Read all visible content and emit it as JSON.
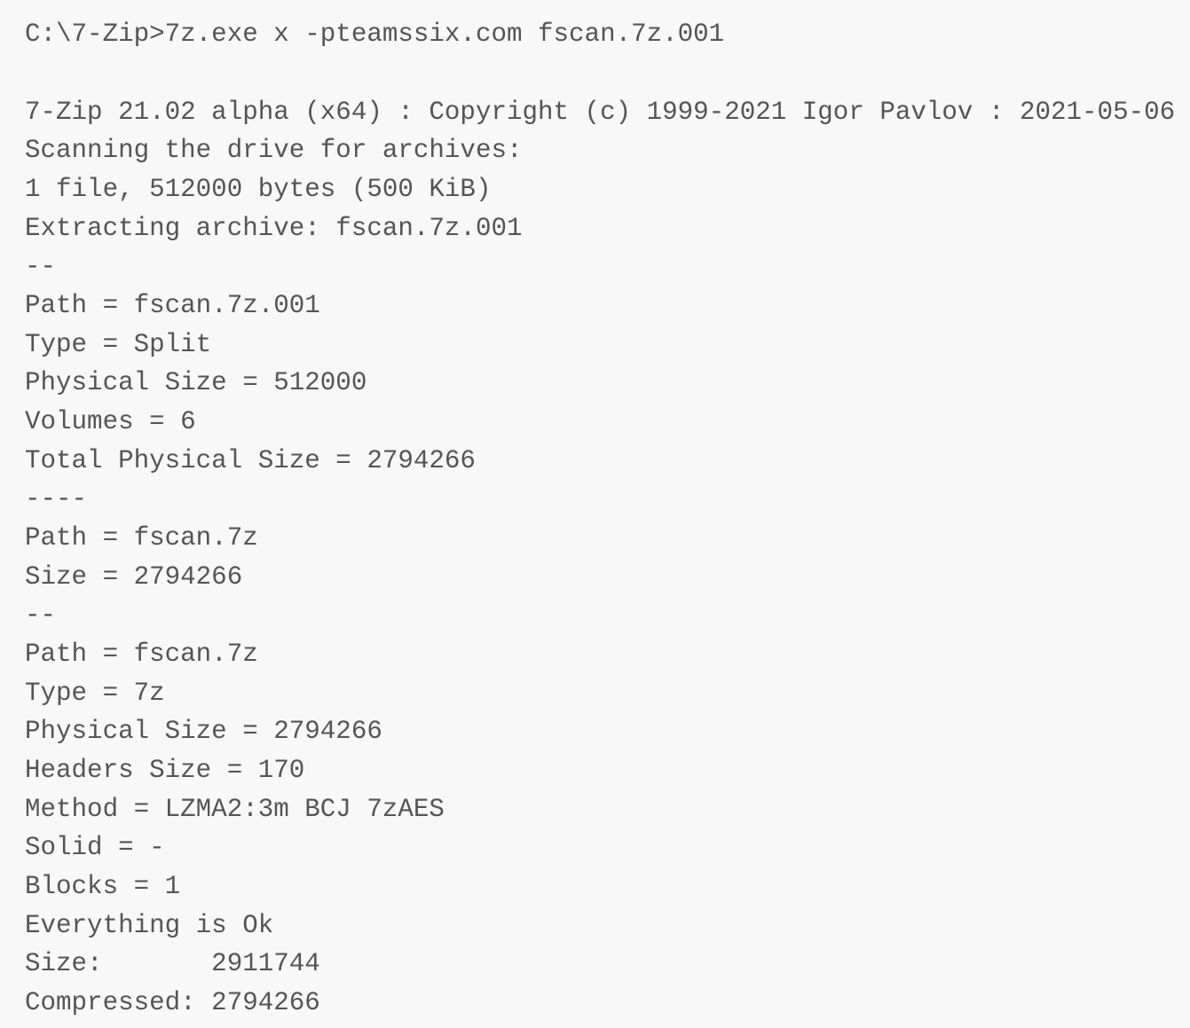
{
  "terminal": {
    "command": "C:\\7-Zip>7z.exe x -pteamssix.com fscan.7z.001",
    "banner": "7-Zip 21.02 alpha (x64) : Copyright (c) 1999-2021 Igor Pavlov : 2021-05-06",
    "scanning": "Scanning the drive for archives:",
    "file_count": "1 file, 512000 bytes (500 KiB)",
    "extracting": "Extracting archive: fscan.7z.001",
    "sep1": "--",
    "split_path": "Path = fscan.7z.001",
    "split_type": "Type = Split",
    "split_physical_size": "Physical Size = 512000",
    "split_volumes": "Volumes = 6",
    "split_total_physical_size": "Total Physical Size = 2794266",
    "sep2": "----",
    "combined_path": "Path = fscan.7z",
    "combined_size": "Size = 2794266",
    "sep3": "--",
    "archive_path": "Path = fscan.7z",
    "archive_type": "Type = 7z",
    "archive_physical_size": "Physical Size = 2794266",
    "archive_headers_size": "Headers Size = 170",
    "archive_method": "Method = LZMA2:3m BCJ 7zAES",
    "archive_solid": "Solid = -",
    "archive_blocks": "Blocks = 1",
    "status": "Everything is Ok",
    "size_total": "Size:       2911744",
    "compressed": "Compressed: 2794266"
  }
}
